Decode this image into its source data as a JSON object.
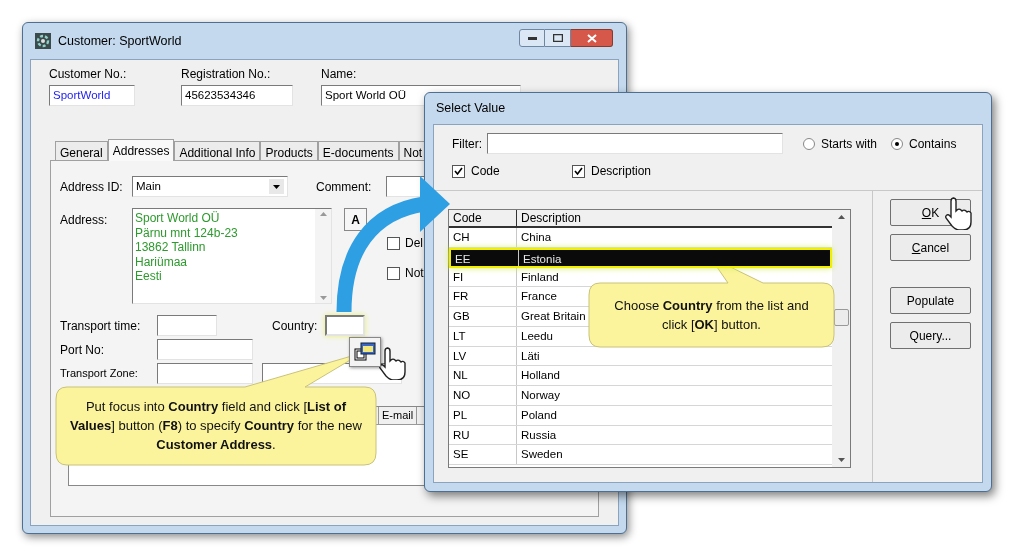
{
  "main_window": {
    "title": "Customer: SportWorld",
    "header_fields": [
      {
        "label": "Customer No.:",
        "value": "SportWorld",
        "kind": "link"
      },
      {
        "label": "Registration No.:",
        "value": "45623534346",
        "kind": "plain"
      },
      {
        "label": "Name:",
        "value": "Sport World OÜ",
        "kind": "plain"
      }
    ],
    "tabs": [
      {
        "label": "General",
        "selected": false
      },
      {
        "label": "Addresses",
        "selected": true
      },
      {
        "label": "Additional Info",
        "selected": false
      },
      {
        "label": "Products",
        "selected": false
      },
      {
        "label": "E-documents",
        "selected": false
      },
      {
        "label": "Not",
        "selected": false
      }
    ],
    "address_id": {
      "label": "Address ID:",
      "value": "Main"
    },
    "comment": {
      "label": "Comment:"
    },
    "address": {
      "label": "Address:",
      "lines": [
        "Sport World OÜ",
        "Pärnu mnt 124b-23",
        "13862 Tallinn",
        "Hariümaa",
        "Eesti"
      ]
    },
    "format_button": "A",
    "flags": [
      {
        "label": "Del",
        "checked": false
      },
      {
        "label": "Not",
        "checked": false
      }
    ],
    "transport_time": {
      "label": "Transport time:"
    },
    "country": {
      "label": "Country:",
      "highlighted": true
    },
    "port_no": {
      "label": "Port No:"
    },
    "transport_zone": {
      "label": "Transport Zone:"
    },
    "grid_columns": [
      "E-mail"
    ]
  },
  "dialog": {
    "title": "Select Value",
    "filter_label": "Filter:",
    "match_modes": [
      {
        "label": "Starts with",
        "selected": false
      },
      {
        "label": "Contains",
        "selected": true
      }
    ],
    "search_in": [
      {
        "label": "Code",
        "checked": true
      },
      {
        "label": "Description",
        "checked": true
      }
    ],
    "columns": [
      "Code",
      "Description"
    ],
    "rows": [
      {
        "code": "CH",
        "description": "China",
        "selected": false
      },
      {
        "code": "EE",
        "description": "Estonia",
        "selected": true
      },
      {
        "code": "FI",
        "description": "Finland",
        "selected": false
      },
      {
        "code": "FR",
        "description": "France",
        "selected": false
      },
      {
        "code": "GB",
        "description": "Great Britain",
        "selected": false
      },
      {
        "code": "LT",
        "description": "Leedu",
        "selected": false
      },
      {
        "code": "LV",
        "description": "Läti",
        "selected": false
      },
      {
        "code": "NL",
        "description": "Holland",
        "selected": false
      },
      {
        "code": "NO",
        "description": "Norway",
        "selected": false
      },
      {
        "code": "PL",
        "description": "Poland",
        "selected": false
      },
      {
        "code": "RU",
        "description": "Russia",
        "selected": false
      },
      {
        "code": "SE",
        "description": "Sweden",
        "selected": false
      }
    ],
    "buttons": [
      {
        "label": "OK",
        "mnemonic": true
      },
      {
        "label": "Cancel",
        "mnemonic": true
      },
      {
        "label": "Populate",
        "mnemonic": false
      },
      {
        "label": "Query...",
        "mnemonic": false
      }
    ]
  },
  "callouts": [
    {
      "text": "Put focus into **Country** field and click [**List of Values**] button (**F8**) to specify **Country** for the new **Customer Address**."
    },
    {
      "text": "Choose **Country** from the list and click [**OK**] button."
    }
  ]
}
